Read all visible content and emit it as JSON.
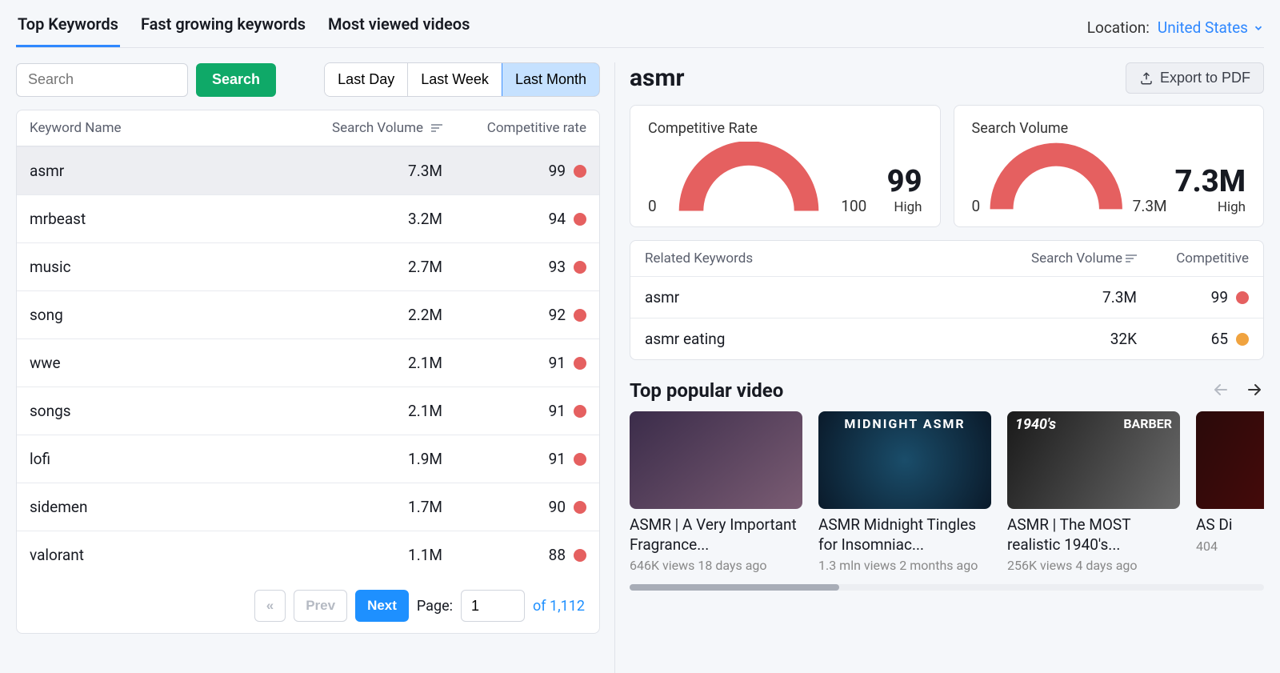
{
  "tabs": [
    "Top Keywords",
    "Fast growing keywords",
    "Most viewed videos"
  ],
  "activeTab": 0,
  "location": {
    "label": "Location:",
    "value": "United States"
  },
  "search": {
    "placeholder": "Search",
    "button": "Search"
  },
  "period": {
    "options": [
      "Last Day",
      "Last Week",
      "Last Month"
    ],
    "active": 2
  },
  "table": {
    "headers": {
      "name": "Keyword Name",
      "volume": "Search Volume",
      "competitive": "Competitive rate"
    },
    "rows": [
      {
        "name": "asmr",
        "volume": "7.3M",
        "competitive": 99,
        "selected": true
      },
      {
        "name": "mrbeast",
        "volume": "3.2M",
        "competitive": 94
      },
      {
        "name": "music",
        "volume": "2.7M",
        "competitive": 93
      },
      {
        "name": "song",
        "volume": "2.2M",
        "competitive": 92
      },
      {
        "name": "wwe",
        "volume": "2.1M",
        "competitive": 91
      },
      {
        "name": "songs",
        "volume": "2.1M",
        "competitive": 91
      },
      {
        "name": "lofi",
        "volume": "1.9M",
        "competitive": 91
      },
      {
        "name": "sidemen",
        "volume": "1.7M",
        "competitive": 90
      },
      {
        "name": "valorant",
        "volume": "1.1M",
        "competitive": 88
      }
    ]
  },
  "pager": {
    "prevprev": "«",
    "prev": "Prev",
    "next": "Next",
    "pageLabel": "Page:",
    "page": "1",
    "ofLabel": "of",
    "total": "1,112"
  },
  "detail": {
    "title": "asmr",
    "export": "Export to PDF",
    "gauges": {
      "competitive": {
        "title": "Competitive Rate",
        "min": "0",
        "max": "100",
        "value": "99",
        "sub": "High"
      },
      "volume": {
        "title": "Search Volume",
        "min": "0",
        "max": "7.3M",
        "value": "7.3M",
        "sub": "High"
      }
    },
    "related": {
      "headers": {
        "name": "Related Keywords",
        "volume": "Search Volume",
        "competitive": "Competitive"
      },
      "rows": [
        {
          "name": "asmr",
          "volume": "7.3M",
          "competitive": 99,
          "color": "red"
        },
        {
          "name": "asmr eating",
          "volume": "32K",
          "competitive": 65,
          "color": "orange"
        }
      ]
    },
    "topVideos": {
      "title": "Top popular video",
      "items": [
        {
          "title": "ASMR | A Very Important Fragrance...",
          "meta": "646K views 18 days ago",
          "overlay": ""
        },
        {
          "title": "ASMR Midnight Tingles for Insomniac...",
          "meta": "1.3 mln views 2 months ago",
          "overlay": "MIDNIGHT ASMR"
        },
        {
          "title": "ASMR | The MOST realistic 1940's...",
          "meta": "256K views 4 days ago",
          "overlayLeft": "1940's",
          "overlayRight": "BARBER"
        },
        {
          "title": "AS Di",
          "meta": "404",
          "overlay": ""
        }
      ]
    }
  }
}
